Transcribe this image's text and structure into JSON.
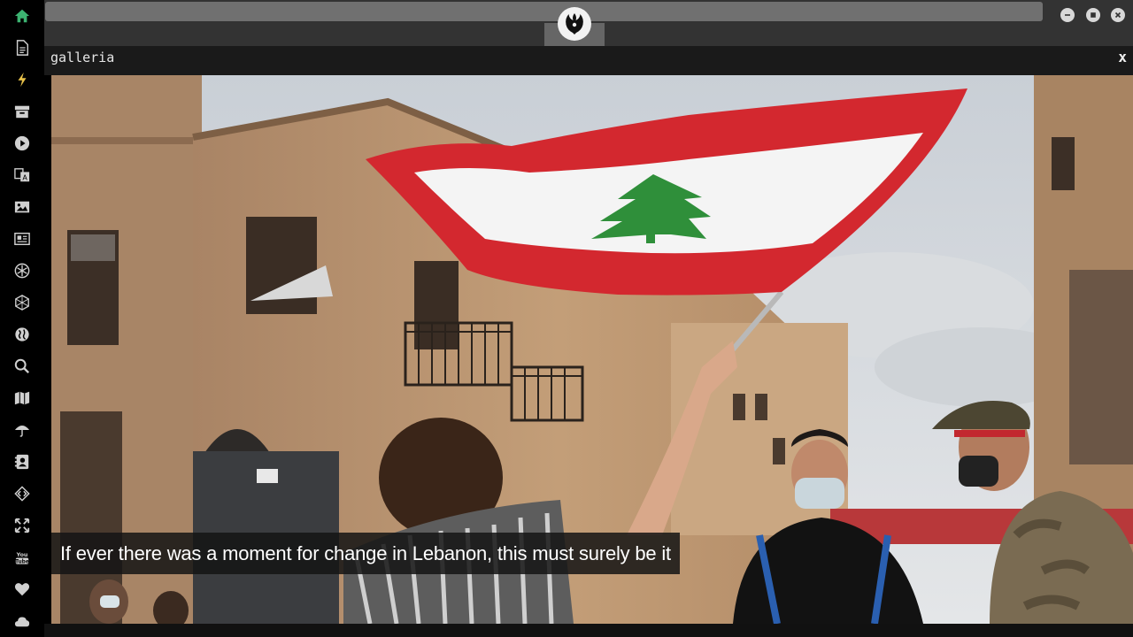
{
  "window": {
    "panel_title": "galleria",
    "close_label": "x",
    "logo_icon": "rebel-alliance-icon"
  },
  "sidebar": {
    "items": [
      {
        "icon": "home-icon",
        "color": "#3cb371"
      },
      {
        "icon": "document-icon",
        "color": "#d0d0d0"
      },
      {
        "icon": "bolt-icon",
        "color": "#e8c24a"
      },
      {
        "icon": "archive-icon",
        "color": "#d0d0d0"
      },
      {
        "icon": "play-icon",
        "color": "#d0d0d0"
      },
      {
        "icon": "translate-icon",
        "color": "#d0d0d0"
      },
      {
        "icon": "image-icon",
        "color": "#d0d0d0"
      },
      {
        "icon": "news-icon",
        "color": "#d0d0d0"
      },
      {
        "icon": "snowflake-icon",
        "color": "#d0d0d0"
      },
      {
        "icon": "network-icon",
        "color": "#d0d0d0"
      },
      {
        "icon": "globe-icon",
        "color": "#d0d0d0"
      },
      {
        "icon": "search-icon",
        "color": "#d0d0d0"
      },
      {
        "icon": "map-icon",
        "color": "#d0d0d0"
      },
      {
        "icon": "umbrella-icon",
        "color": "#d0d0d0"
      },
      {
        "icon": "contact-icon",
        "color": "#d0d0d0"
      },
      {
        "icon": "code-icon",
        "color": "#d0d0d0"
      },
      {
        "icon": "expand-icon",
        "color": "#d0d0d0"
      },
      {
        "icon": "youtube-icon",
        "color": "#d0d0d0"
      },
      {
        "icon": "heart-icon",
        "color": "#d0d0d0"
      },
      {
        "icon": "cloud-icon",
        "color": "#d0d0d0"
      }
    ]
  },
  "gallery": {
    "caption": "If ever there was a moment for change in Lebanon, this must surely be it"
  },
  "colors": {
    "flag_red": "#d3282f",
    "flag_green": "#2f8f3a",
    "accent_green": "#3cb371"
  }
}
